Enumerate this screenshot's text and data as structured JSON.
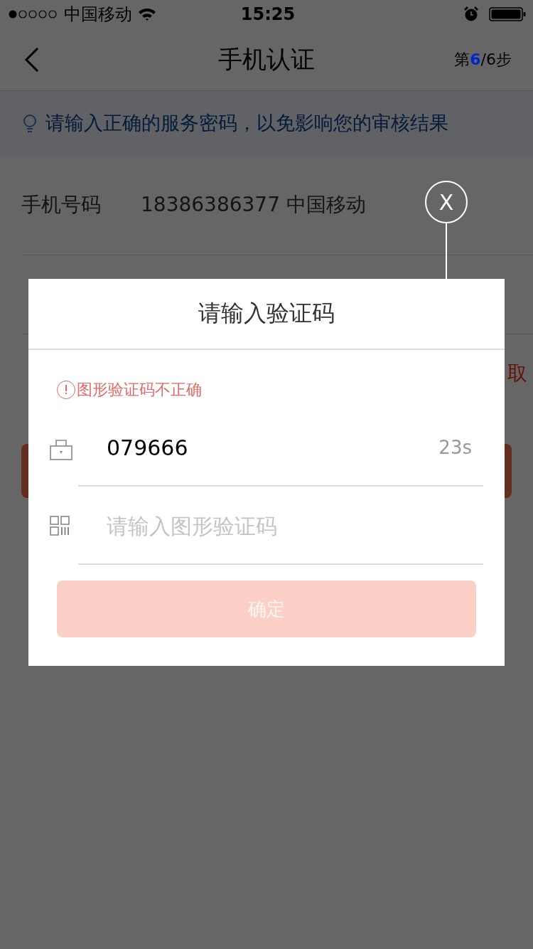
{
  "status_bar": {
    "carrier": "中国移动",
    "time": "15:25"
  },
  "nav": {
    "title": "手机认证",
    "step": {
      "prefix": "第",
      "current": "6",
      "suffix": "/6步"
    }
  },
  "tip": {
    "text": "请输入正确的服务密码，以免影响您的审核结果"
  },
  "phone_row": {
    "label": "手机号码",
    "value": "18386386377 中国移动"
  },
  "code_row": {
    "action": "取"
  },
  "close_button": {
    "label": "X"
  },
  "dialog": {
    "title": "请输入验证码",
    "error": "图形验证码不正确",
    "fields": [
      {
        "kind": "code",
        "value": "079666",
        "countdown": "23s"
      },
      {
        "kind": "captcha",
        "placeholder": "请输入图形验证码"
      }
    ],
    "confirm": {
      "label": "确定",
      "disabled": true
    }
  }
}
